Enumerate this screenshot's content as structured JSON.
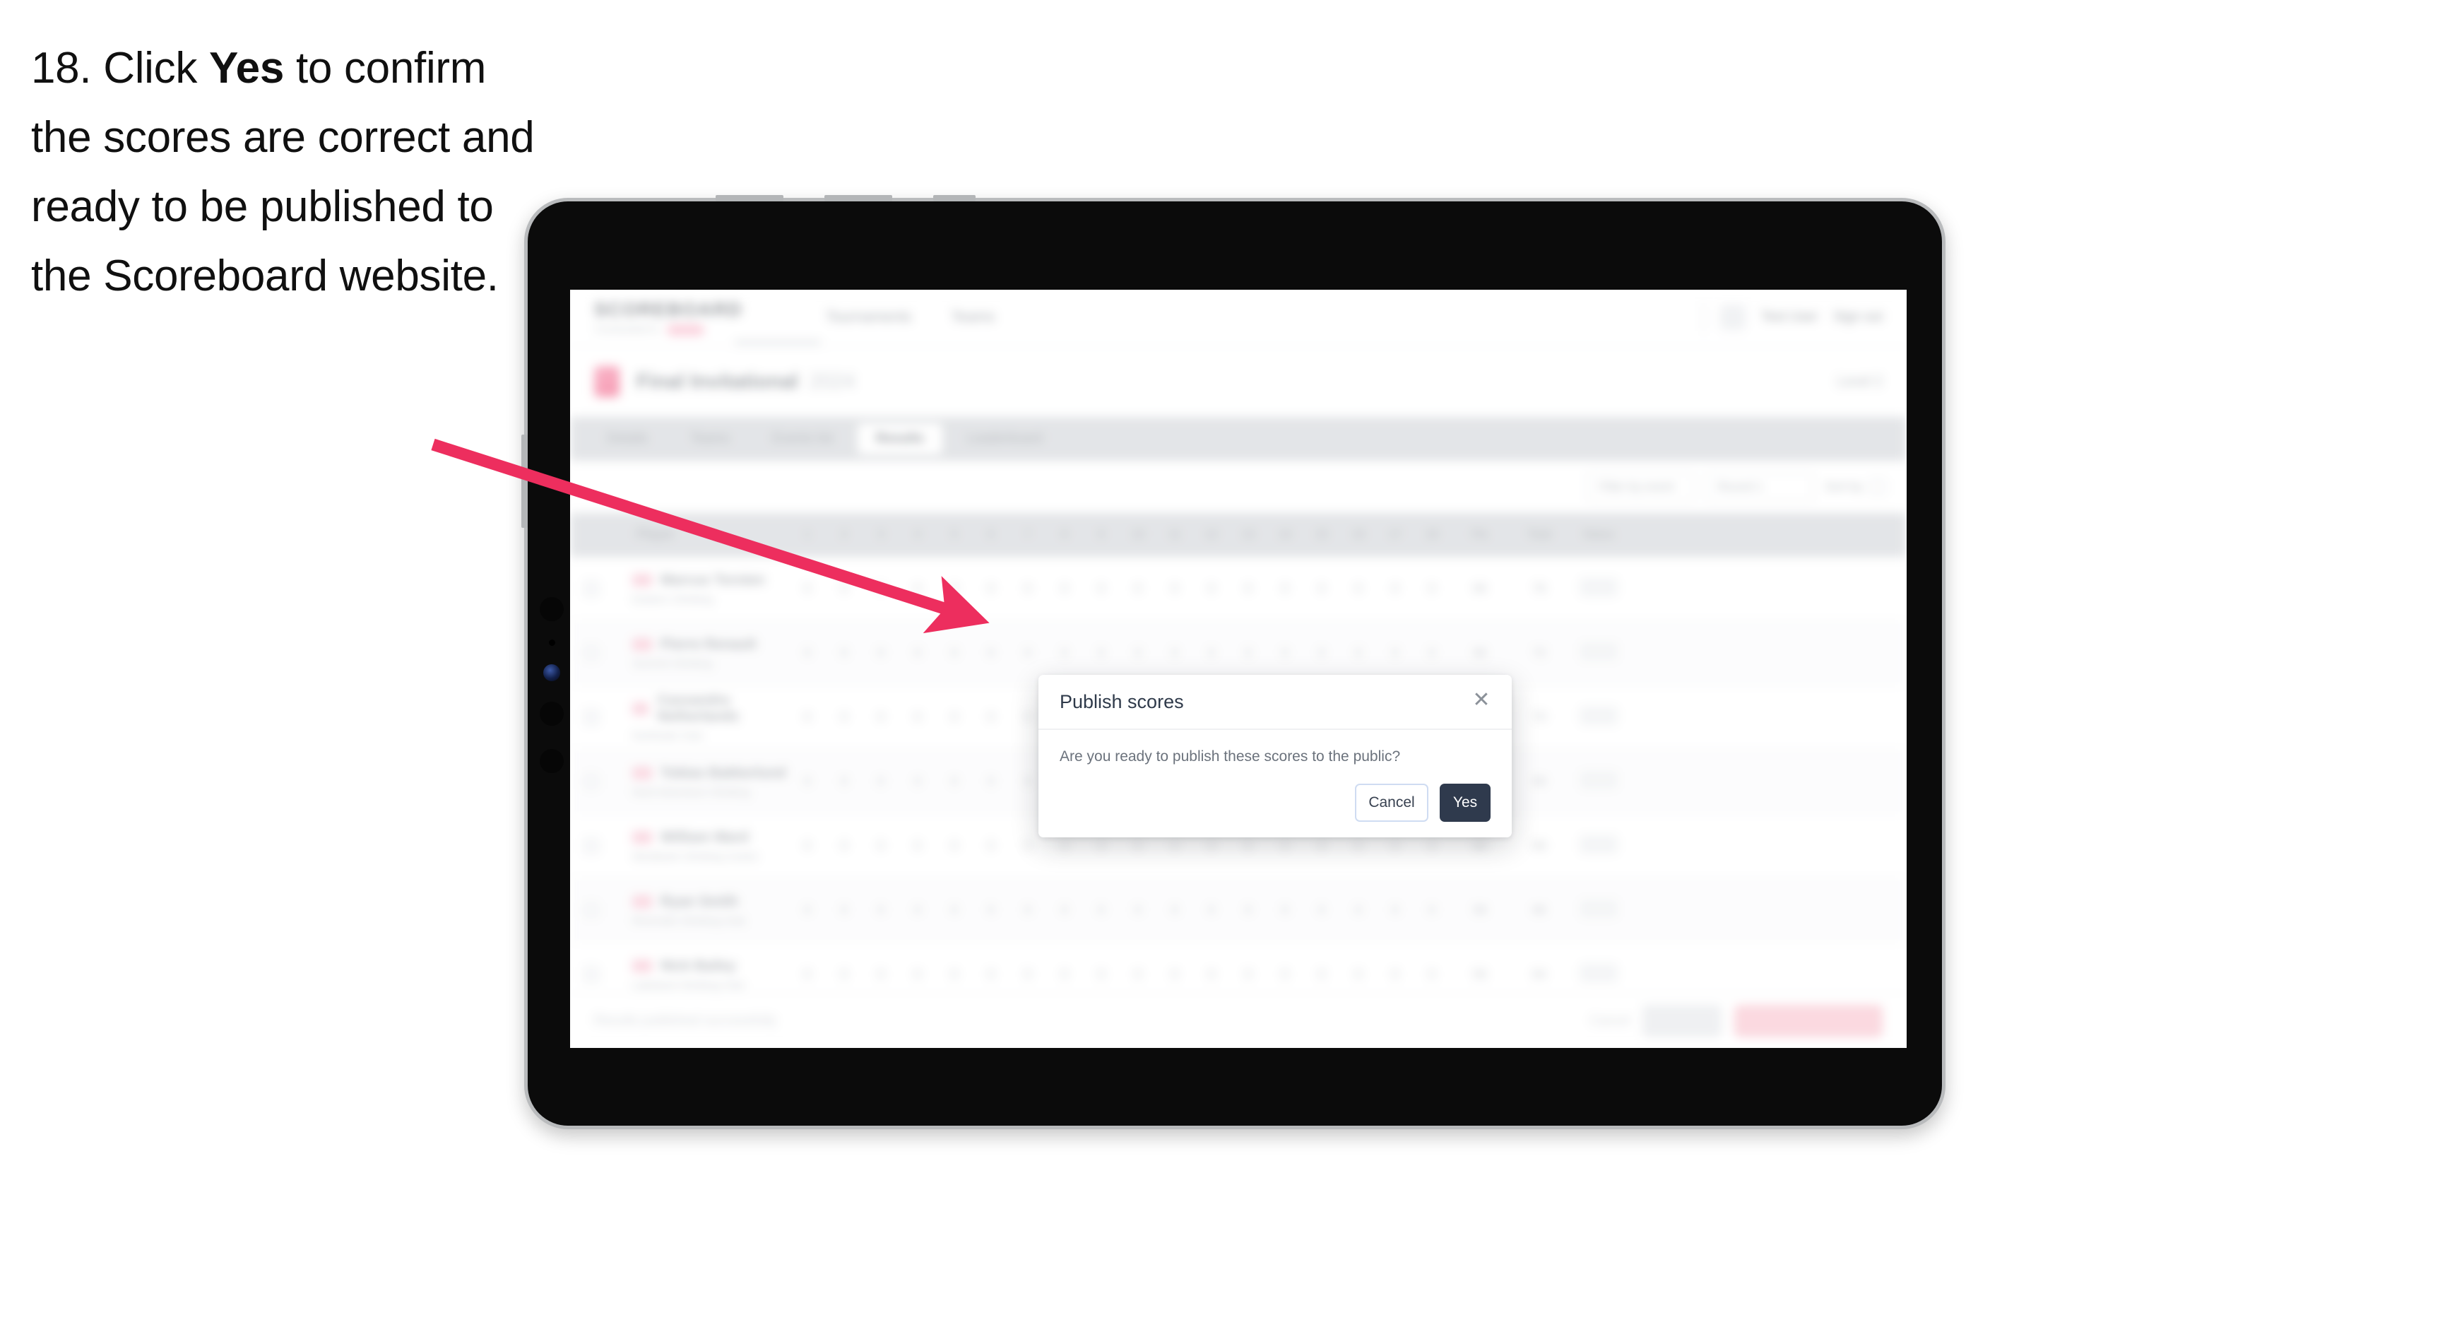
{
  "caption": {
    "number": "18.",
    "before_bold": "Click",
    "bold": "Yes",
    "after_bold": "to confirm the scores are correct and ready to be published to the Scoreboard website.",
    "full": "18. Click Yes to confirm the scores are correct and ready to be published to the Scoreboard website."
  },
  "colors": {
    "arrow": "#ed2e5e",
    "primary_button": "#2f3a4d",
    "brand_pink": "#ec2a5c",
    "cancel_border": "#cfdcf2",
    "tab_strip": "#d3d6da",
    "device_body": "#0b0b0b",
    "device_bezel": "#b9bbbd"
  },
  "device": {
    "kind": "tablet",
    "orientation": "landscape"
  },
  "modal": {
    "title": "Publish scores",
    "message": "Are you ready to publish these scores to the public?",
    "close_icon": "✕",
    "cancel_label": "Cancel",
    "confirm_label": "Yes"
  },
  "app": {
    "brand": "SCOREBOARD",
    "brand_sub": "TOURNAMENTS",
    "brand_pill": "BETA",
    "nav": [
      {
        "label": "Tournaments"
      },
      {
        "label": "Teams"
      }
    ],
    "user_name": "Test User",
    "sign_out": "Sign out",
    "event": {
      "title": "Final Invitational",
      "year": "2024",
      "right_label": "Level 2"
    },
    "tabs": [
      {
        "label": "Details",
        "active": false
      },
      {
        "label": "Teams",
        "active": false
      },
      {
        "label": "Events list",
        "active": false
      },
      {
        "label": "Results",
        "active": true
      },
      {
        "label": "Leaderboard",
        "active": false
      }
    ],
    "filters": {
      "search_placeholder": "Search",
      "selects": [
        {
          "value": "Filter by event"
        },
        {
          "value": "Round 1"
        }
      ],
      "sort_label": "Sort by"
    },
    "table": {
      "headers": [
        "",
        "Player",
        "1",
        "2",
        "3",
        "4",
        "5",
        "6",
        "7",
        "8",
        "9",
        "10",
        "11",
        "12",
        "13",
        "14",
        "15",
        "16",
        "17",
        "18",
        "Pts",
        "Total",
        "Status"
      ],
      "rows": [
        {
          "name": "Marcus Torsten",
          "club": "Eastern Climbing",
          "scores": [
            "0",
            "0",
            "0",
            "0",
            "0",
            "0",
            "0",
            "0",
            "0",
            "0",
            "0",
            "0",
            "0",
            "0",
            "0",
            "0",
            "0",
            "0"
          ],
          "pts": "66",
          "total": "76",
          "status": "Final"
        },
        {
          "name": "Pierre Renault",
          "club": "Summit Climbing",
          "scores": [
            "0",
            "0",
            "0",
            "0",
            "0",
            "0",
            "0",
            "0",
            "0",
            "0",
            "0",
            "0",
            "0",
            "0",
            "0",
            "0",
            "0",
            "0"
          ],
          "pts": "66",
          "total": "72",
          "status": "Final"
        },
        {
          "name": "Cassandra Netherlands",
          "club": "Northside Club",
          "scores": [
            "0",
            "0",
            "0",
            "0",
            "0",
            "0",
            "0",
            "0",
            "0",
            "0",
            "0",
            "0",
            "0",
            "0",
            "0",
            "0",
            "0",
            "0"
          ],
          "pts": "64",
          "total": "70",
          "status": "Final"
        },
        {
          "name": "Tobias Bakkerlund",
          "club": "Nord Adventure Climbing",
          "scores": [
            "0",
            "0",
            "0",
            "0",
            "0",
            "0",
            "0",
            "0",
            "0",
            "0",
            "0",
            "0",
            "0",
            "0",
            "0",
            "0",
            "0",
            "0"
          ],
          "pts": "62",
          "total": "69",
          "status": "Final"
        },
        {
          "name": "William Ward",
          "club": "Westbank Climbing Centre",
          "scores": [
            "0",
            "0",
            "0",
            "0",
            "0",
            "0",
            "0",
            "0",
            "0",
            "0",
            "0",
            "0",
            "0",
            "0",
            "0",
            "0",
            "0",
            "0"
          ],
          "pts": "60",
          "total": "68",
          "status": "Final"
        },
        {
          "name": "Ryan Smith",
          "club": "Riverside Climbing Club",
          "scores": [
            "0",
            "0",
            "0",
            "0",
            "0",
            "0",
            "0",
            "0",
            "0",
            "0",
            "0",
            "0",
            "0",
            "0",
            "0",
            "0",
            "0",
            "0"
          ],
          "pts": "58",
          "total": "66",
          "status": "Final"
        },
        {
          "name": "Nick Bailey",
          "club": "Lakeland Climbing Club",
          "scores": [
            "0",
            "0",
            "0",
            "0",
            "0",
            "0",
            "0",
            "0",
            "0",
            "0",
            "0",
            "0",
            "0",
            "0",
            "0",
            "0",
            "0",
            "0"
          ],
          "pts": "56",
          "total": "64",
          "status": "Final"
        }
      ]
    },
    "bottom": {
      "note": "Results published successfully",
      "link_label": "Cancel",
      "secondary_label": "Save all",
      "primary_label": "Publish to Scoreboard"
    }
  }
}
